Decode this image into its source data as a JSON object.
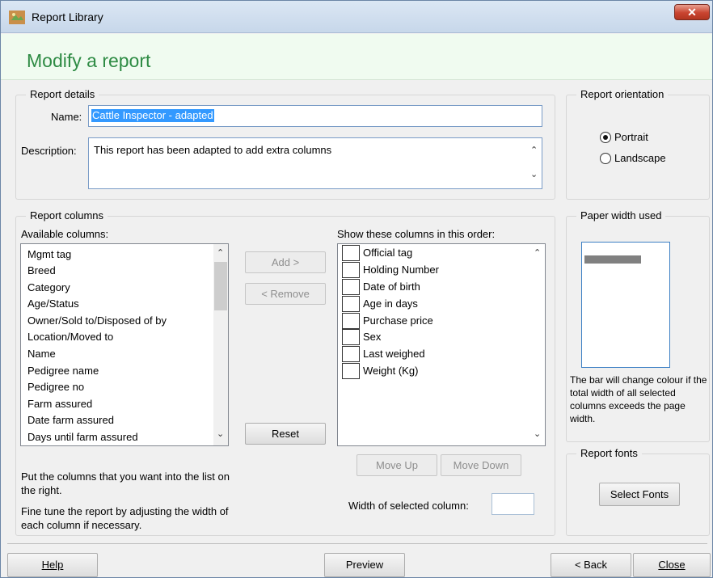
{
  "window": {
    "title": "Report Library",
    "close_glyph": "✕"
  },
  "header": {
    "title": "Modify a report"
  },
  "details": {
    "legend": "Report details",
    "name_label": "Name:",
    "name_value": "Cattle Inspector - adapted",
    "description_label": "Description:",
    "description_value": "This report has been adapted to add extra columns"
  },
  "orientation": {
    "legend": "Report orientation",
    "options": [
      {
        "label": "Portrait",
        "checked": true
      },
      {
        "label": "Landscape",
        "checked": false
      }
    ]
  },
  "columns": {
    "legend": "Report columns",
    "available_label": "Available columns:",
    "available": [
      "Mgmt tag",
      "Breed",
      "Category",
      "Age/Status",
      "Owner/Sold to/Disposed of by",
      "Location/Moved to",
      "Name",
      "Pedigree name",
      "Pedigree no",
      "Farm assured",
      "Date farm assured",
      "Days until farm assured"
    ],
    "add_label": "Add >",
    "remove_label": "< Remove",
    "reset_label": "Reset",
    "selected_label": "Show these columns in this order:",
    "selected": [
      "Official tag",
      "Holding Number",
      "Date of birth",
      "Age in days",
      "Purchase price",
      "Sex",
      "Last weighed",
      "Weight (Kg)"
    ],
    "move_up_label": "Move Up",
    "move_down_label": "Move Down",
    "hint1": "Put the columns that you want into the list on the right.",
    "hint2": "Fine tune the report by adjusting the width of each column if necessary.",
    "width_label": "Width of selected column:",
    "width_value": ""
  },
  "paper": {
    "legend": "Paper width used",
    "note": "The bar will change colour if the total width of all selected columns exceeds the page width."
  },
  "fonts": {
    "legend": "Report fonts",
    "button_label": "Select Fonts"
  },
  "footer": {
    "help_label": "Help",
    "preview_label": "Preview",
    "back_label": "< Back",
    "close_label": "Close"
  },
  "colors": {
    "accent_green": "#2e8b44",
    "selection_blue": "#3399ff"
  }
}
